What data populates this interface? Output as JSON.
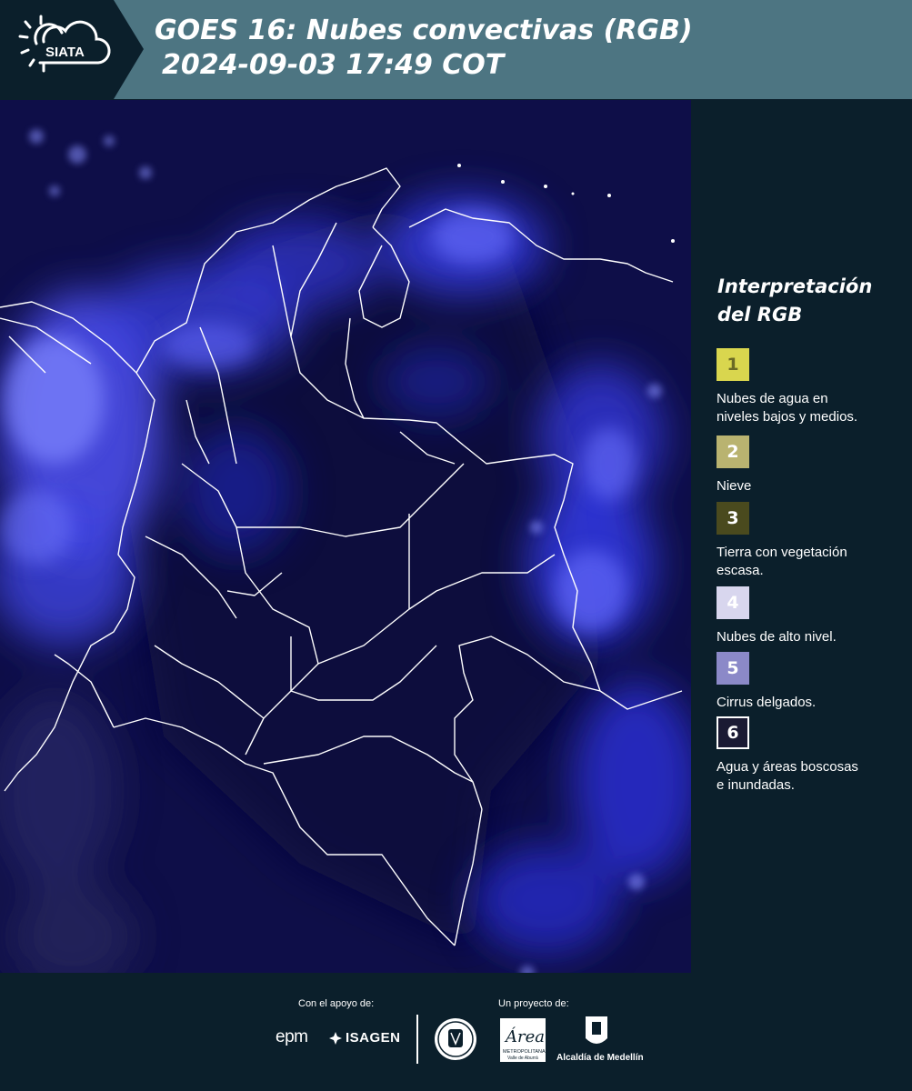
{
  "header": {
    "logo_text": "SIATA",
    "title_line1": "GOES 16: Nubes convectivas (RGB)",
    "title_line2": "2024-09-03 17:49 COT"
  },
  "map": {
    "caption": "",
    "background_color": "#0e0e48",
    "border_color": "#ffffff"
  },
  "legend": {
    "title_line1": "Interpretación",
    "title_line2": "del RGB",
    "items": [
      {
        "number": "1",
        "label_line1": "Nubes de agua en",
        "label_line2": "niveles bajos y medios.",
        "color": "#d9d64e",
        "text_color": "#6b6a25"
      },
      {
        "number": "2",
        "label_line1": "Nieve",
        "label_line2": "",
        "color": "#b9b370",
        "text_color": "#ffffff"
      },
      {
        "number": "3",
        "label_line1": "Tierra con vegetación",
        "label_line2": "escasa.",
        "color": "#4a4a1e",
        "text_color": "#ffffff"
      },
      {
        "number": "4",
        "label_line1": "Nubes de alto nivel.",
        "label_line2": "",
        "color": "#d8d6ee",
        "text_color": "#ffffff"
      },
      {
        "number": "5",
        "label_line1": "Cirrus delgados.",
        "label_line2": "",
        "color": "#8b89c8",
        "text_color": "#ffffff"
      },
      {
        "number": "6",
        "label_line1": "Agua y áreas boscosas",
        "label_line2": "e inundadas.",
        "color": "#1a1a33",
        "text_color": "#ffffff"
      }
    ]
  },
  "footer": {
    "support_label": "Con el apoyo de:",
    "project_label": "Un proyecto de:",
    "epm": "epm",
    "isagen": "ISAGEN",
    "area_name": "Área",
    "area_sub1": "METROPOLITANA",
    "area_sub2": "Valle de Aburrá",
    "alcaldia": "Alcaldía de Medellín"
  }
}
